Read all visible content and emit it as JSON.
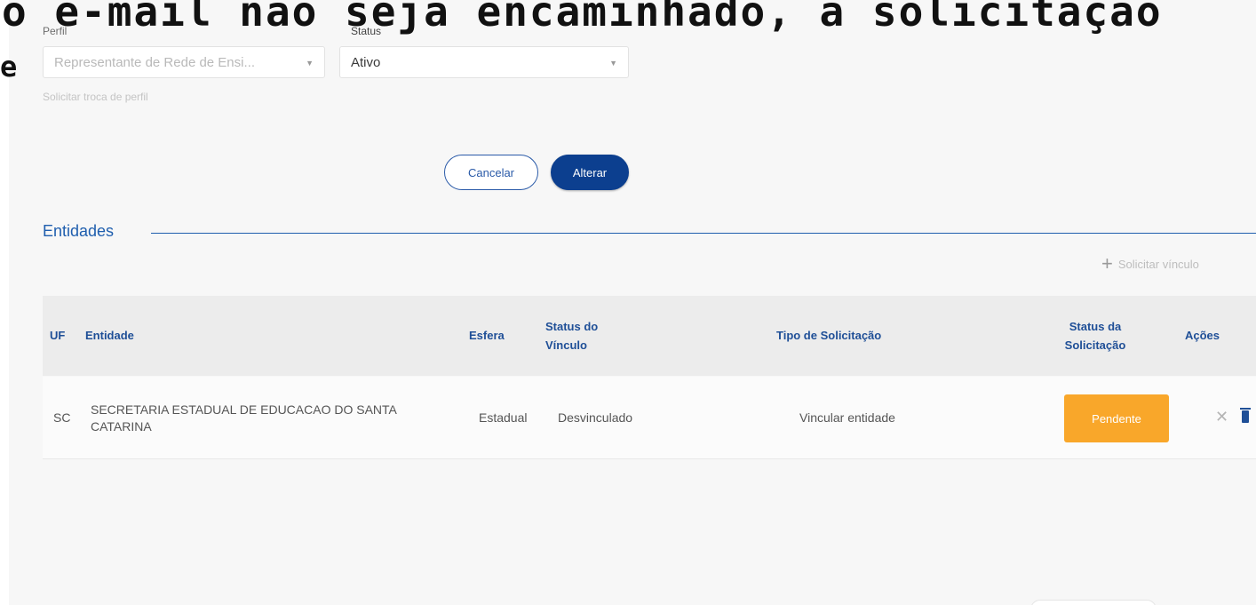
{
  "overlay": {
    "headline": "o e-mail não seja encaminhado, a solicitação",
    "second_line_start": "e"
  },
  "form": {
    "profile_label": "Perfil",
    "profile_value": "Representante de Rede de Ensi...",
    "status_label": "Status",
    "status_value": "Ativo",
    "change_profile_link": "Solicitar troca de perfil",
    "cancel_label": "Cancelar",
    "submit_label": "Alterar"
  },
  "entities": {
    "title": "Entidades",
    "request_link": "Solicitar vínculo",
    "columns": {
      "uf": "UF",
      "entity": "Entidade",
      "sphere": "Esfera",
      "link_status": "Status do Vínculo",
      "request_type": "Tipo de Solicitação",
      "request_status": "Status da Solicitação",
      "actions": "Ações"
    },
    "rows": [
      {
        "uf": "SC",
        "entity": "SECRETARIA ESTADUAL DE EDUCACAO DO SANTA CATARINA",
        "sphere": "Estadual",
        "link_status": "Desvinculado",
        "request_type": "Vincular entidade",
        "request_status": "Pendente"
      }
    ]
  },
  "colors": {
    "primary": "#0c3f8f",
    "accent_blue": "#1f5eae",
    "pending": "#f9a72a"
  },
  "icons": [
    "close-icon",
    "trash-icon",
    "plus-icon",
    "chevron-down-icon"
  ]
}
